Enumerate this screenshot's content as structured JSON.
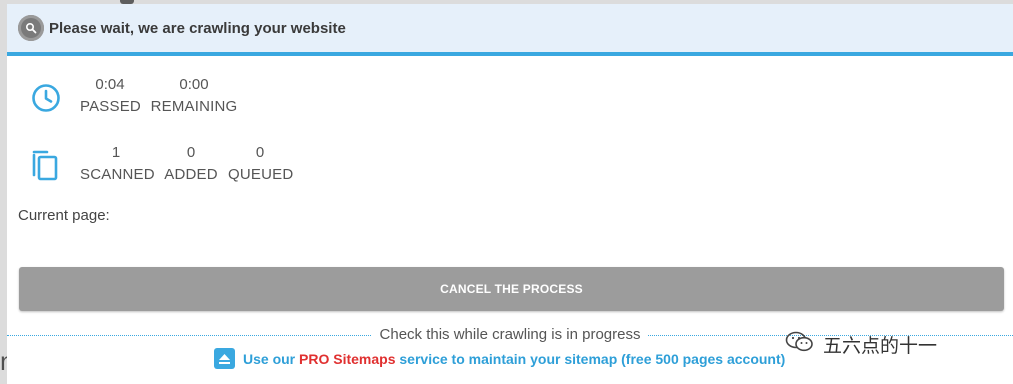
{
  "modal": {
    "title": "Please wait, we are crawling your website",
    "colors": {
      "accent": "#3aa8e0",
      "header_bg": "#e6f0fa",
      "button_bg": "#9c9c9c",
      "pro_red": "#e03030"
    }
  },
  "time_stats": {
    "icon": "clock-icon",
    "items": [
      {
        "value": "0:04",
        "label": "PASSED"
      },
      {
        "value": "0:00",
        "label": "REMAINING"
      }
    ]
  },
  "page_stats": {
    "icon": "copy-pages-icon",
    "items": [
      {
        "value": "1",
        "label": "SCANNED"
      },
      {
        "value": "0",
        "label": "ADDED"
      },
      {
        "value": "0",
        "label": "QUEUED"
      }
    ]
  },
  "current_page": {
    "label": "Current page:"
  },
  "cancel_button": {
    "label": "CANCEL THE PROCESS"
  },
  "footer": {
    "check_text": "Check this while crawling is in progress",
    "promo_prefix": "Use our ",
    "promo_pro": "PRO Sitemaps",
    "promo_suffix": " service to maintain your sitemap (free 500 pages account)",
    "promo_icon": "upload-icon"
  },
  "watermark": {
    "text": "五六点的十一",
    "icon": "wechat-icon"
  },
  "background": {
    "heading_fragment": "n"
  }
}
